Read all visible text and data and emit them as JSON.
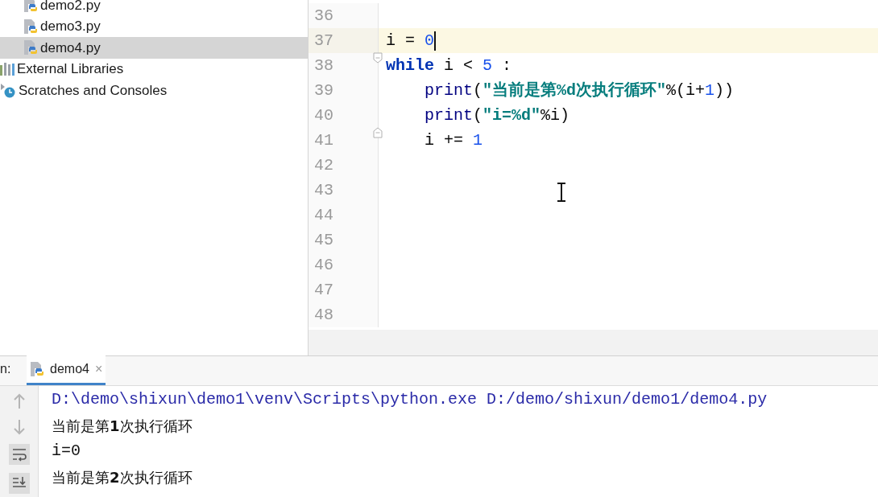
{
  "project_tree": {
    "items": [
      {
        "label": "demo2.py",
        "kind": "python_file",
        "selected": false
      },
      {
        "label": "demo3.py",
        "kind": "python_file",
        "selected": false
      },
      {
        "label": "demo4.py",
        "kind": "python_file",
        "selected": true
      },
      {
        "label": "External Libraries",
        "kind": "libraries",
        "selected": false
      },
      {
        "label": "Scratches and Consoles",
        "kind": "scratches",
        "selected": false
      }
    ]
  },
  "editor": {
    "lines": [
      {
        "number": "36",
        "current": false,
        "fold_start": false,
        "fold_end": false,
        "caret": false
      },
      {
        "number": "37",
        "current": true,
        "fold_start": false,
        "fold_end": false,
        "caret": true,
        "tokens": [
          {
            "text": "i = ",
            "kind": "plain"
          },
          {
            "text": "0",
            "kind": "number"
          }
        ]
      },
      {
        "number": "38",
        "current": false,
        "fold_start": true,
        "fold_end": false,
        "caret": false,
        "tokens": [
          {
            "text": "while",
            "kind": "keyword"
          },
          {
            "text": " i < ",
            "kind": "plain"
          },
          {
            "text": "5",
            "kind": "number"
          },
          {
            "text": " :",
            "kind": "plain"
          }
        ]
      },
      {
        "number": "39",
        "current": false,
        "fold_start": false,
        "fold_end": false,
        "caret": false,
        "tokens": [
          {
            "text": "    print",
            "kind": "builtin"
          },
          {
            "text": "(",
            "kind": "plain"
          },
          {
            "text": "\"当前是第%d次执行循环\"",
            "kind": "string"
          },
          {
            "text": "%(i+",
            "kind": "plain"
          },
          {
            "text": "1",
            "kind": "number"
          },
          {
            "text": "))",
            "kind": "plain"
          }
        ]
      },
      {
        "number": "40",
        "current": false,
        "fold_start": false,
        "fold_end": false,
        "caret": false,
        "tokens": [
          {
            "text": "    print",
            "kind": "builtin"
          },
          {
            "text": "(",
            "kind": "plain"
          },
          {
            "text": "\"i=%d\"",
            "kind": "string"
          },
          {
            "text": "%i)",
            "kind": "plain"
          }
        ]
      },
      {
        "number": "41",
        "current": false,
        "fold_start": false,
        "fold_end": true,
        "caret": false,
        "tokens": [
          {
            "text": "    i += ",
            "kind": "plain"
          },
          {
            "text": "1",
            "kind": "number"
          }
        ]
      },
      {
        "number": "42",
        "current": false,
        "fold_start": false,
        "fold_end": false,
        "caret": false
      },
      {
        "number": "43",
        "current": false,
        "fold_start": false,
        "fold_end": false,
        "caret": false
      },
      {
        "number": "44",
        "current": false,
        "fold_start": false,
        "fold_end": false,
        "caret": false
      },
      {
        "number": "45",
        "current": false,
        "fold_start": false,
        "fold_end": false,
        "caret": false
      },
      {
        "number": "46",
        "current": false,
        "fold_start": false,
        "fold_end": false,
        "caret": false
      },
      {
        "number": "47",
        "current": false,
        "fold_start": false,
        "fold_end": false,
        "caret": false
      },
      {
        "number": "48",
        "current": false,
        "fold_start": false,
        "fold_end": false,
        "caret": false
      }
    ]
  },
  "run_panel": {
    "label": "n:",
    "tab": {
      "label": "demo4",
      "close": "×",
      "selected": true
    },
    "output": [
      {
        "text": "D:\\demo\\shixun\\demo1\\venv\\Scripts\\python.exe D:/demo/shixun/demo1/demo4.py",
        "kind": "command"
      },
      {
        "text": "当前是第**1**次执行循环",
        "kind": "stdout"
      },
      {
        "text": "i=0",
        "kind": "stdout_mono"
      },
      {
        "text": "当前是第**2**次执行循环",
        "kind": "stdout"
      }
    ]
  }
}
